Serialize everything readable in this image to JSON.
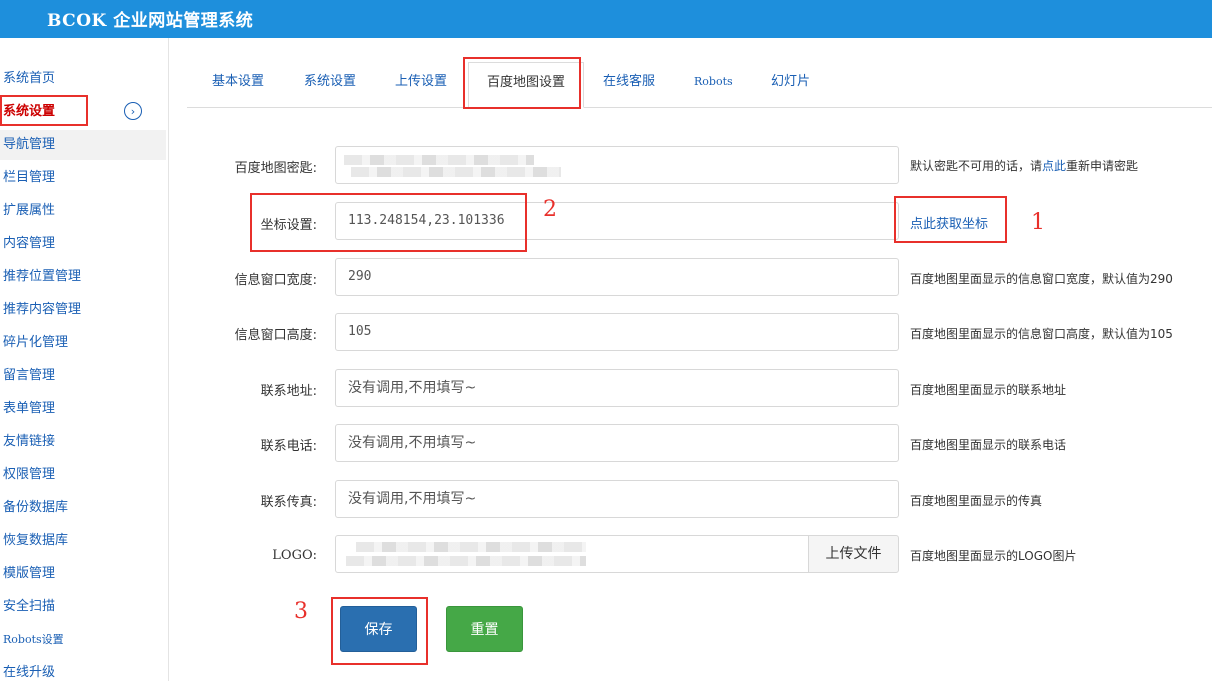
{
  "header": {
    "title": "BCOK 企业网站管理系统"
  },
  "sidebar": {
    "items": [
      {
        "label": "系统首页"
      },
      {
        "label": "系统设置"
      },
      {
        "label": "导航管理"
      },
      {
        "label": "栏目管理"
      },
      {
        "label": "扩展属性"
      },
      {
        "label": "内容管理"
      },
      {
        "label": "推荐位置管理"
      },
      {
        "label": "推荐内容管理"
      },
      {
        "label": "碎片化管理"
      },
      {
        "label": "留言管理"
      },
      {
        "label": "表单管理"
      },
      {
        "label": "友情链接"
      },
      {
        "label": "权限管理"
      },
      {
        "label": "备份数据库"
      },
      {
        "label": "恢复数据库"
      },
      {
        "label": "模版管理"
      },
      {
        "label": "安全扫描"
      },
      {
        "label": "Robots设置"
      },
      {
        "label": "在线升级"
      }
    ],
    "toggle_icon": "›"
  },
  "tabs": [
    {
      "label": "基本设置"
    },
    {
      "label": "系统设置"
    },
    {
      "label": "上传设置"
    },
    {
      "label": "百度地图设置"
    },
    {
      "label": "在线客服"
    },
    {
      "label": "Robots"
    },
    {
      "label": "幻灯片"
    }
  ],
  "form": {
    "key": {
      "label": "百度地图密匙:",
      "hint_prefix": "默认密匙不可用的话，请",
      "hint_link": "点此",
      "hint_suffix": "重新申请密匙"
    },
    "coord": {
      "label": "坐标设置:",
      "value": "113.248154,23.101336",
      "link": "点此获取坐标"
    },
    "width": {
      "label": "信息窗口宽度:",
      "value": "290",
      "hint": "百度地图里面显示的信息窗口宽度，默认值为290"
    },
    "height": {
      "label": "信息窗口高度:",
      "value": "105",
      "hint": "百度地图里面显示的信息窗口高度，默认值为105"
    },
    "address": {
      "label": "联系地址:",
      "value": "没有调用,不用填写~",
      "hint": "百度地图里面显示的联系地址"
    },
    "phone": {
      "label": "联系电话:",
      "value": "没有调用,不用填写~",
      "hint": "百度地图里面显示的联系电话"
    },
    "fax": {
      "label": "联系传真:",
      "value": "没有调用,不用填写~",
      "hint": "百度地图里面显示的传真"
    },
    "logo": {
      "label": "LOGO:",
      "upload": "上传文件",
      "hint": "百度地图里面显示的LOGO图片"
    }
  },
  "buttons": {
    "save": "保存",
    "reset": "重置"
  },
  "annotations": {
    "n1": "1",
    "n2": "2",
    "n3": "3"
  }
}
